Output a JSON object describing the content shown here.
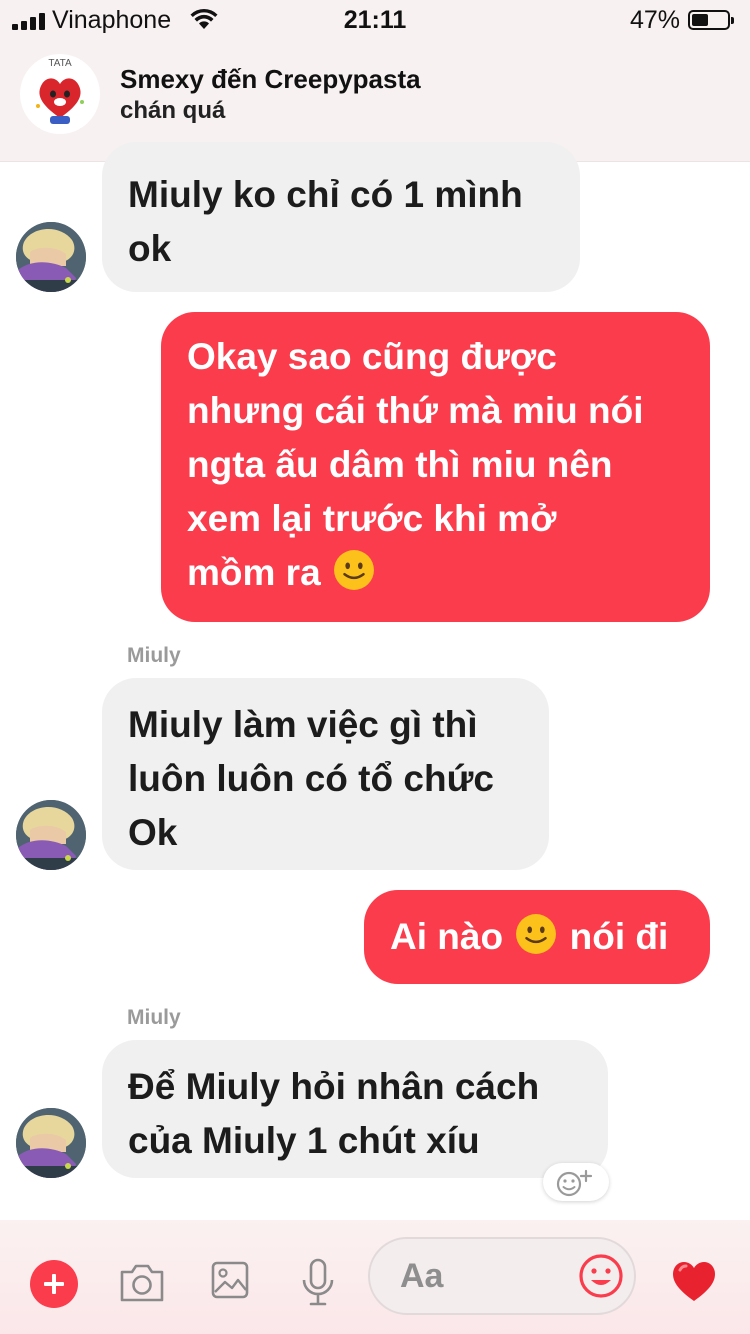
{
  "status_bar": {
    "carrier": "Vinaphone",
    "time": "21:11",
    "battery_percent": "47%",
    "battery_level": 0.47
  },
  "header": {
    "avatar_logo_text": "TATA",
    "title": "Smexy đến Creepypasta",
    "subtitle": "chán quá"
  },
  "messages": [
    {
      "direction": "incoming",
      "lines": [
        "Miuly ko chỉ có 1 mình",
        "ok"
      ]
    },
    {
      "direction": "outgoing",
      "lines": [
        "Okay sao cũng được",
        "nhưng cái thứ mà miu nói",
        "ngta ấu dâm thì miu nên",
        "xem lại trước khi mở",
        "mồm ra"
      ],
      "trailing_emoji": "slightly-smiling-face-emoji"
    },
    {
      "direction": "incoming",
      "sender": "Miuly",
      "lines": [
        "Miuly làm việc gì thì",
        "luôn luôn có tổ chức",
        "Ok"
      ]
    },
    {
      "direction": "outgoing",
      "parts": [
        "Ai nào",
        "nói đi"
      ],
      "inline_emoji": "slightly-smiling-face-emoji"
    },
    {
      "direction": "incoming",
      "sender": "Miuly",
      "lines": [
        "Để Miuly hỏi nhân cách",
        "của Miuly 1 chút xíu"
      ]
    }
  ],
  "composer": {
    "placeholder": "Aa",
    "icons": [
      "plus-icon",
      "camera-icon",
      "image-icon",
      "microphone-icon",
      "emoji-icon",
      "heart-icon"
    ]
  },
  "colors": {
    "accent": "#fa3c4c",
    "incoming_bubble": "#f0f0f0",
    "header_bg": "#f7f1f1"
  }
}
